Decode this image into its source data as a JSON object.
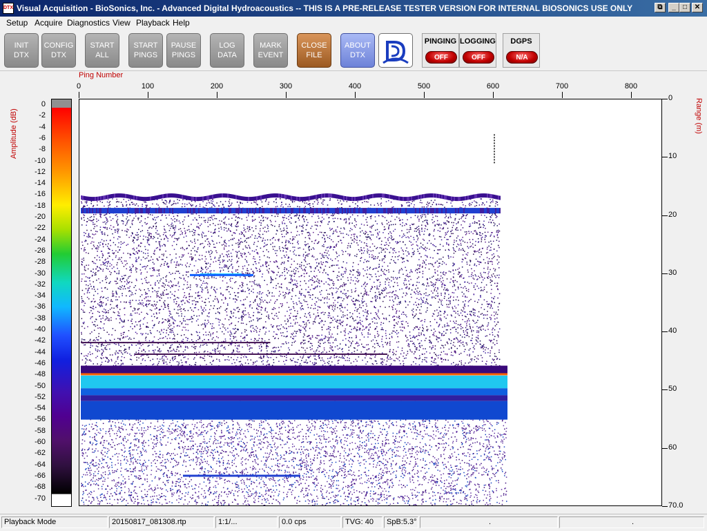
{
  "window": {
    "title": "Visual Acquisition  -  BioSonics, Inc.  -  Advanced Digital Hydroacoustics  -- THIS IS A PRE-RELEASE TESTER VERSION FOR INTERNAL BIOSONICS USE ONLY",
    "icon_text": "DTX"
  },
  "menu": [
    "Setup",
    "Acquire",
    "Diagnostics",
    "View",
    "Playback",
    "Help"
  ],
  "toolbar": {
    "buttons": [
      {
        "l1": "INIT",
        "l2": "DTX"
      },
      {
        "l1": "CONFIG",
        "l2": "DTX"
      },
      {
        "l1": "START",
        "l2": "ALL"
      },
      {
        "l1": "START",
        "l2": "PINGS"
      },
      {
        "l1": "PAUSE",
        "l2": "PINGS"
      },
      {
        "l1": "LOG",
        "l2": "DATA"
      },
      {
        "l1": "MARK",
        "l2": "EVENT"
      },
      {
        "l1": "CLOSE",
        "l2": "FILE"
      },
      {
        "l1": "ABOUT",
        "l2": "DTX"
      }
    ],
    "indicators": [
      {
        "label": "PINGING",
        "state": "OFF"
      },
      {
        "label": "LOGGING",
        "state": "OFF"
      },
      {
        "label": "DGPS",
        "state": "N/A"
      }
    ]
  },
  "echogram": {
    "ping_axis_title": "Ping Number",
    "ping_ticks": [
      "0",
      "100",
      "200",
      "300",
      "400",
      "500",
      "600",
      "700",
      "800"
    ],
    "amplitude_title": "Amplitude (dB)",
    "amplitude_ticks": [
      "0",
      "-2",
      "-4",
      "-6",
      "-8",
      "-10",
      "-12",
      "-14",
      "-16",
      "-18",
      "-20",
      "-22",
      "-24",
      "-26",
      "-28",
      "-30",
      "-32",
      "-34",
      "-36",
      "-38",
      "-40",
      "-42",
      "-44",
      "-46",
      "-48",
      "-50",
      "-52",
      "-54",
      "-56",
      "-58",
      "-60",
      "-62",
      "-64",
      "-66",
      "-68",
      "-70"
    ],
    "range_title": "Range (m)",
    "range_ticks": [
      "0",
      "10",
      "20",
      "30",
      "40",
      "50",
      "60",
      "70.0"
    ],
    "ping_max": 850,
    "range_max": 70,
    "pings_recorded": 610,
    "colors": {
      "bottom": "#20d0ff",
      "bottom_edge": "#ff6000",
      "noise": "#3a0a7a",
      "fish": "#1060ff"
    }
  },
  "status": {
    "mode": "Playback Mode",
    "file": "20150817_081308.rtp",
    "ratio": "1:1/...",
    "rate": "0.0 cps",
    "tvg": "TVG: 40",
    "spb": "SpB:5.3°",
    "extra1": ".",
    "extra2": "."
  }
}
